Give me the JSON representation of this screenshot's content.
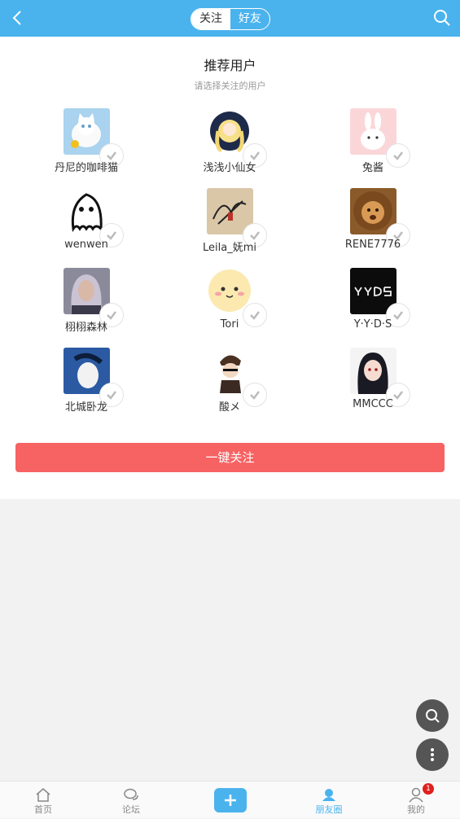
{
  "header": {
    "tabs": [
      {
        "label": "关注",
        "active": true
      },
      {
        "label": "好友",
        "active": false
      }
    ]
  },
  "recommend": {
    "title": "推荐用户",
    "subtitle": "请选择关注的用户",
    "users": [
      {
        "name": "丹尼的咖啡猫",
        "avatar": "white-cat-photo"
      },
      {
        "name": "浅浅小仙女",
        "avatar": "anime-girl-crescent"
      },
      {
        "name": "兔酱",
        "avatar": "cartoon-bunny"
      },
      {
        "name": "wenwen",
        "avatar": "ghost-doodle"
      },
      {
        "name": "Leila_妩mi",
        "avatar": "signature-art"
      },
      {
        "name": "RENE7776",
        "avatar": "lion-photo"
      },
      {
        "name": "栩栩森林",
        "avatar": "silver-hair-portrait"
      },
      {
        "name": "Tori",
        "avatar": "cute-face-cartoon"
      },
      {
        "name": "Y·Y·D·S",
        "avatar": "yyds-logo"
      },
      {
        "name": "北城卧龙",
        "avatar": "blue-portrait"
      },
      {
        "name": "酸メ",
        "avatar": "chibi-boy"
      },
      {
        "name": "MMCCC",
        "avatar": "anime-dark-hair"
      }
    ],
    "follow_all_label": "一键关注"
  },
  "tabbar": {
    "items": [
      {
        "label": "首页",
        "icon": "home-icon"
      },
      {
        "label": "论坛",
        "icon": "chat-icon"
      },
      {
        "label": "",
        "icon": "plus-icon"
      },
      {
        "label": "朋友圈",
        "icon": "friends-icon",
        "active": true
      },
      {
        "label": "我的",
        "icon": "profile-icon",
        "badge": "1"
      }
    ]
  },
  "colors": {
    "primary": "#4ab3ee",
    "accent": "#f76262",
    "badge": "#e02020"
  }
}
